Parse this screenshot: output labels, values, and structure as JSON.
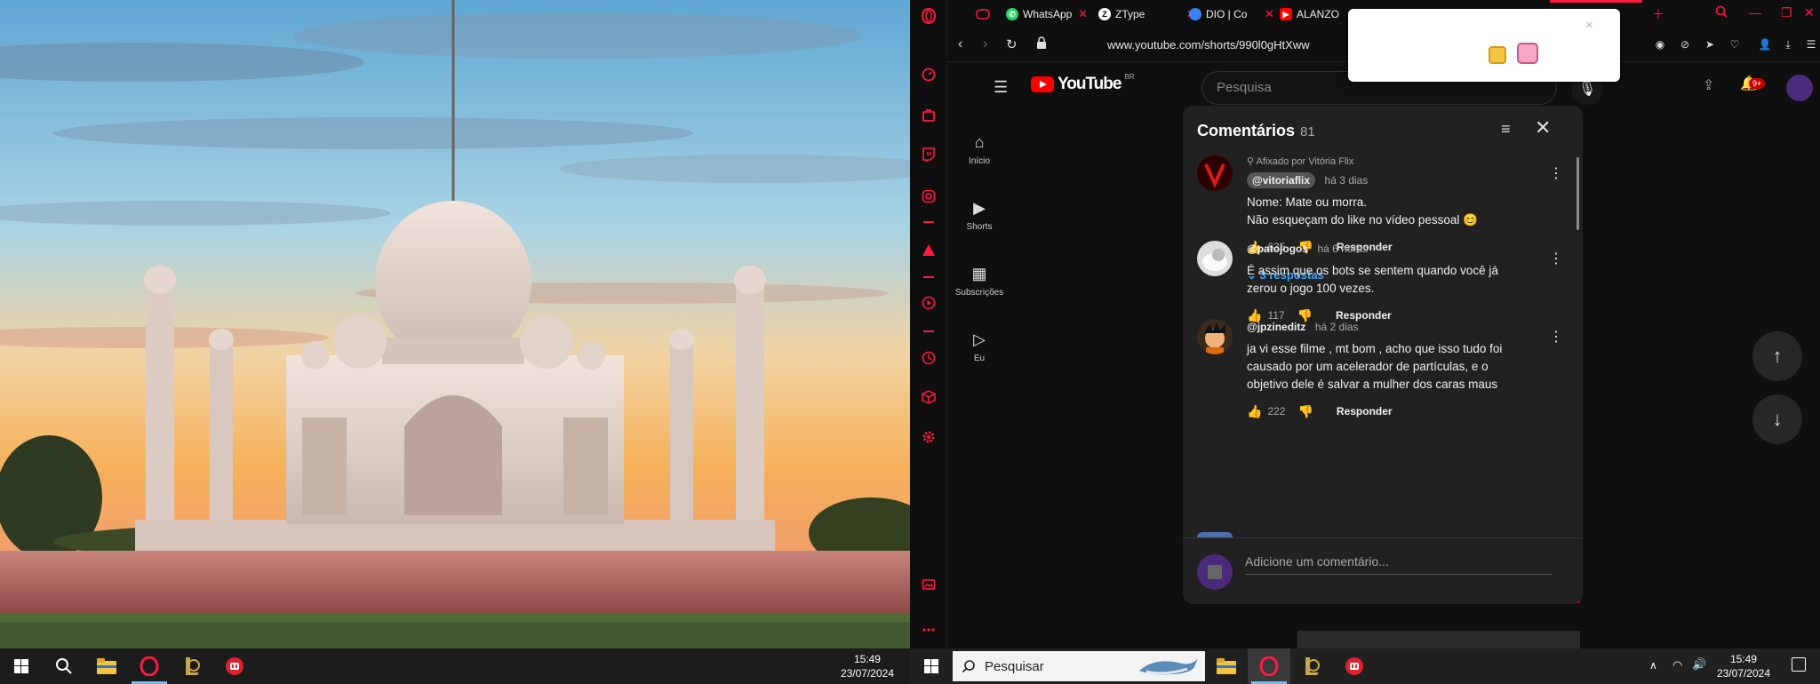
{
  "left_taskbar": {
    "time": "15:49",
    "date": "23/07/2024"
  },
  "right_taskbar": {
    "search_placeholder": "Pesquisar",
    "time": "15:49",
    "date": "23/07/2024"
  },
  "tabs": [
    {
      "label": "WhatsApp",
      "icon": "whatsapp-icon",
      "color": "#25d366"
    },
    {
      "label": "ZType",
      "icon": "ztype-icon",
      "color": "#ffffff"
    },
    {
      "label": "DIO | Co",
      "icon": "dio-icon",
      "color": "#3b82f6"
    },
    {
      "label": "ALANZO",
      "icon": "youtube-icon",
      "color": "#ff0000"
    }
  ],
  "address": {
    "url": "www.youtube.com/shorts/990l0gHtXww"
  },
  "youtube": {
    "logo": "YouTube",
    "region": "BR",
    "search_placeholder": "Pesquisa",
    "notification_badge": "9+",
    "nav": [
      {
        "label": "Início",
        "icon": "home-icon"
      },
      {
        "label": "Shorts",
        "icon": "shorts-icon"
      },
      {
        "label": "Subscrições",
        "icon": "subscriptions-icon"
      },
      {
        "label": "Eu",
        "icon": "you-icon"
      }
    ]
  },
  "comments_panel": {
    "title": "Comentários",
    "count": "81",
    "input_placeholder": "Adicione um comentário...",
    "reply_label": "Responder",
    "pinned_label": "Afixado por Vitória Flix",
    "comments": [
      {
        "author": "@vitoriaflix",
        "time": "há 3 dias",
        "text_lines": [
          "Nome: Mate ou morra.",
          "Não esqueçam do like no vídeo pessoal 😊"
        ],
        "likes": "635",
        "replies_label": "3 respostas"
      },
      {
        "author": "@patojogos",
        "time": "há 6 horas",
        "text_lines": [
          "É assim que os bots se sentem quando você já",
          "zerou o jogo 100 vezes."
        ],
        "likes": "117"
      },
      {
        "author": "@jpzineditz",
        "time": "há 2 dias",
        "text_lines": [
          "ja vi esse filme , mt bom , acho que isso tudo foi",
          "causado por um acelerador de partículas, e o",
          "objetivo dele é salvar a mulher dos caras maus"
        ],
        "likes": "222"
      }
    ]
  },
  "colors": {
    "opera_accent": "#ff1a40",
    "yt_red": "#ff0000",
    "link_blue": "#3ea6ff"
  }
}
